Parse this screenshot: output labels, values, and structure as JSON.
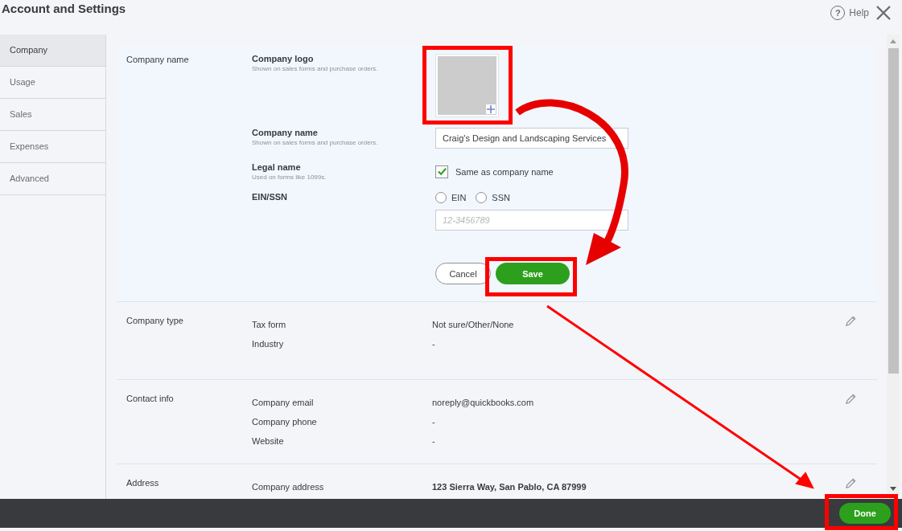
{
  "window": {
    "title": "Account and Settings"
  },
  "help": {
    "icon": "?",
    "label": "Help"
  },
  "sidebar": {
    "items": [
      {
        "label": "Company",
        "selected": true
      },
      {
        "label": "Usage",
        "selected": false
      },
      {
        "label": "Sales",
        "selected": false
      },
      {
        "label": "Expenses",
        "selected": false
      },
      {
        "label": "Advanced",
        "selected": false
      }
    ]
  },
  "company_name_section": {
    "heading": "Company name",
    "logo": {
      "label": "Company logo",
      "hint": "Shown on sales forms and purchase orders."
    },
    "name": {
      "label": "Company name",
      "hint": "Shown on sales forms and purchase orders.",
      "value": "Craig's Design and Landscaping Services"
    },
    "legal": {
      "label": "Legal name",
      "hint": "Used on forms like 1099s.",
      "checkbox": {
        "label": "Same as company name",
        "checked": true
      }
    },
    "ein_ssn": {
      "label": "EIN/SSN",
      "options": [
        {
          "label": "EIN",
          "selected": false
        },
        {
          "label": "SSN",
          "selected": false
        }
      ],
      "placeholder": "12-3456789"
    },
    "cancel": "Cancel",
    "save": "Save"
  },
  "sections": [
    {
      "heading": "Company type",
      "rows": [
        {
          "label": "Tax form",
          "value": "Not sure/Other/None",
          "bold": false
        },
        {
          "label": "Industry",
          "value": "-",
          "bold": false
        }
      ]
    },
    {
      "heading": "Contact info",
      "rows": [
        {
          "label": "Company email",
          "value": "noreply@quickbooks.com",
          "bold": false
        },
        {
          "label": "Company phone",
          "value": "-",
          "bold": false
        },
        {
          "label": "Website",
          "value": "-",
          "bold": false
        }
      ]
    },
    {
      "heading": "Address",
      "rows": [
        {
          "label": "Company address",
          "value": "123 Sierra Way, San Pablo, CA 87999",
          "bold": true
        }
      ]
    }
  ],
  "footer": {
    "done": "Done"
  }
}
